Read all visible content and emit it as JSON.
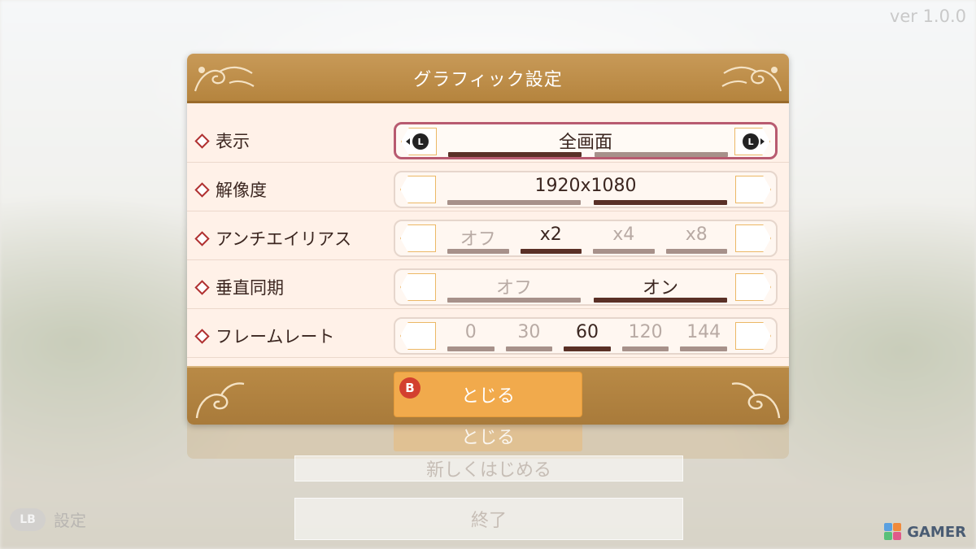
{
  "version": "ver 1.0.0",
  "dialog": {
    "title": "グラフィック設定",
    "rows": [
      {
        "label": "表示",
        "type": "center",
        "value": "全画面",
        "segments": 2,
        "selected": 0,
        "active": true
      },
      {
        "label": "解像度",
        "type": "center",
        "value": "1920x1080",
        "segments": 2,
        "selected": 1,
        "active": false
      },
      {
        "label": "アンチエイリアス",
        "type": "options",
        "options": [
          "オフ",
          "x2",
          "x4",
          "x8"
        ],
        "selected": 1
      },
      {
        "label": "垂直同期",
        "type": "options",
        "options": [
          "オフ",
          "オン"
        ],
        "selected": 1
      },
      {
        "label": "フレームレート",
        "type": "options",
        "options": [
          "0",
          "30",
          "60",
          "120",
          "144"
        ],
        "selected": 2
      }
    ],
    "close_label": "とじる",
    "close_button_badge": "B",
    "l_button_glyph": "L"
  },
  "background_menu": {
    "ghost_close": "とじる",
    "ghost_item": "新しくはじめる",
    "quit": "終了"
  },
  "lb_hint": {
    "badge": "LB",
    "label": "設定"
  },
  "watermark": "GAMER",
  "colors": {
    "header": "#b5843e",
    "panel": "#fff1e8",
    "active_border": "#b85b70",
    "selected_bar": "#5a3026",
    "unselected_bar": "#a7918a",
    "close_button": "#f1aa4c"
  }
}
